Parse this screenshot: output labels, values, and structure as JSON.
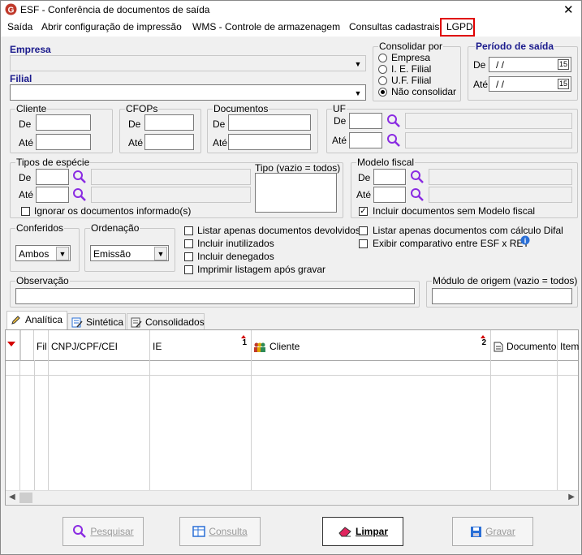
{
  "window": {
    "title": "ESF - Conferência de documentos de saída",
    "close_glyph": "✕"
  },
  "menu": [
    "Saída",
    "Abrir configuração de impressão",
    "WMS - Controle de armazenagem",
    "Consultas cadastrais",
    "LGPD"
  ],
  "empresa": {
    "label": "Empresa",
    "value": ""
  },
  "filial": {
    "label": "Filial",
    "value": ""
  },
  "consolidar": {
    "title": "Consolidar por",
    "options": [
      "Empresa",
      "I. E. Filial",
      "U.F. Filial",
      "Não consolidar"
    ],
    "selected": "Não consolidar"
  },
  "periodo": {
    "title": "Período de saída",
    "de_label": "De",
    "ate_label": "Até",
    "de_value": " / /",
    "ate_value": " / /",
    "cal_glyph": "15"
  },
  "cliente": {
    "title": "Cliente",
    "de": "De",
    "ate": "Até"
  },
  "cfops": {
    "title": "CFOPs",
    "de": "De",
    "ate": "Até"
  },
  "documentos": {
    "title": "Documentos",
    "de": "De",
    "ate": "Até"
  },
  "uf": {
    "title": "UF",
    "de": "De",
    "ate": "Até"
  },
  "especie": {
    "title": "Tipos de espécie",
    "de": "De",
    "ate": "Até",
    "ignore_label": "Ignorar os documentos informado(s)",
    "ignore_checked": false
  },
  "tipo": {
    "title": "Tipo (vazio = todos)"
  },
  "modelo": {
    "title": "Modelo fiscal",
    "de": "De",
    "ate": "Até",
    "include_label": "Incluir documentos sem Modelo fiscal",
    "include_checked": true
  },
  "conferidos": {
    "title": "Conferidos",
    "value": "Ambos"
  },
  "ordenacao": {
    "title": "Ordenação",
    "value": "Emissão"
  },
  "checks_mid": [
    "Listar apenas documentos devolvidos",
    "Incluir inutilizados",
    "Incluir denegados",
    "Imprimir listagem após gravar"
  ],
  "checks_right": [
    "Listar apenas documentos com cálculo Difal",
    "Exibir comparativo entre ESF x  RET"
  ],
  "observacao": {
    "title": "Observação"
  },
  "modulo": {
    "title": "Módulo de origem (vazio = todos)"
  },
  "tabs": [
    "Analítica",
    "Sintética",
    "Consolidados"
  ],
  "grid": {
    "columns": [
      "Fil",
      "CNPJ/CPF/CEI",
      "IE",
      "Cliente",
      "Documento",
      "Item"
    ],
    "sort_ie": "1",
    "sort_cliente": "2"
  },
  "buttons": {
    "pesquisar": "Pesquisar",
    "consulta": "Consulta",
    "limpar": "Limpar",
    "gravar": "Gravar"
  },
  "colors": {
    "accent_red": "#e00000",
    "lens_purple": "#8a2be2",
    "period_title": "#1a1a8c"
  }
}
